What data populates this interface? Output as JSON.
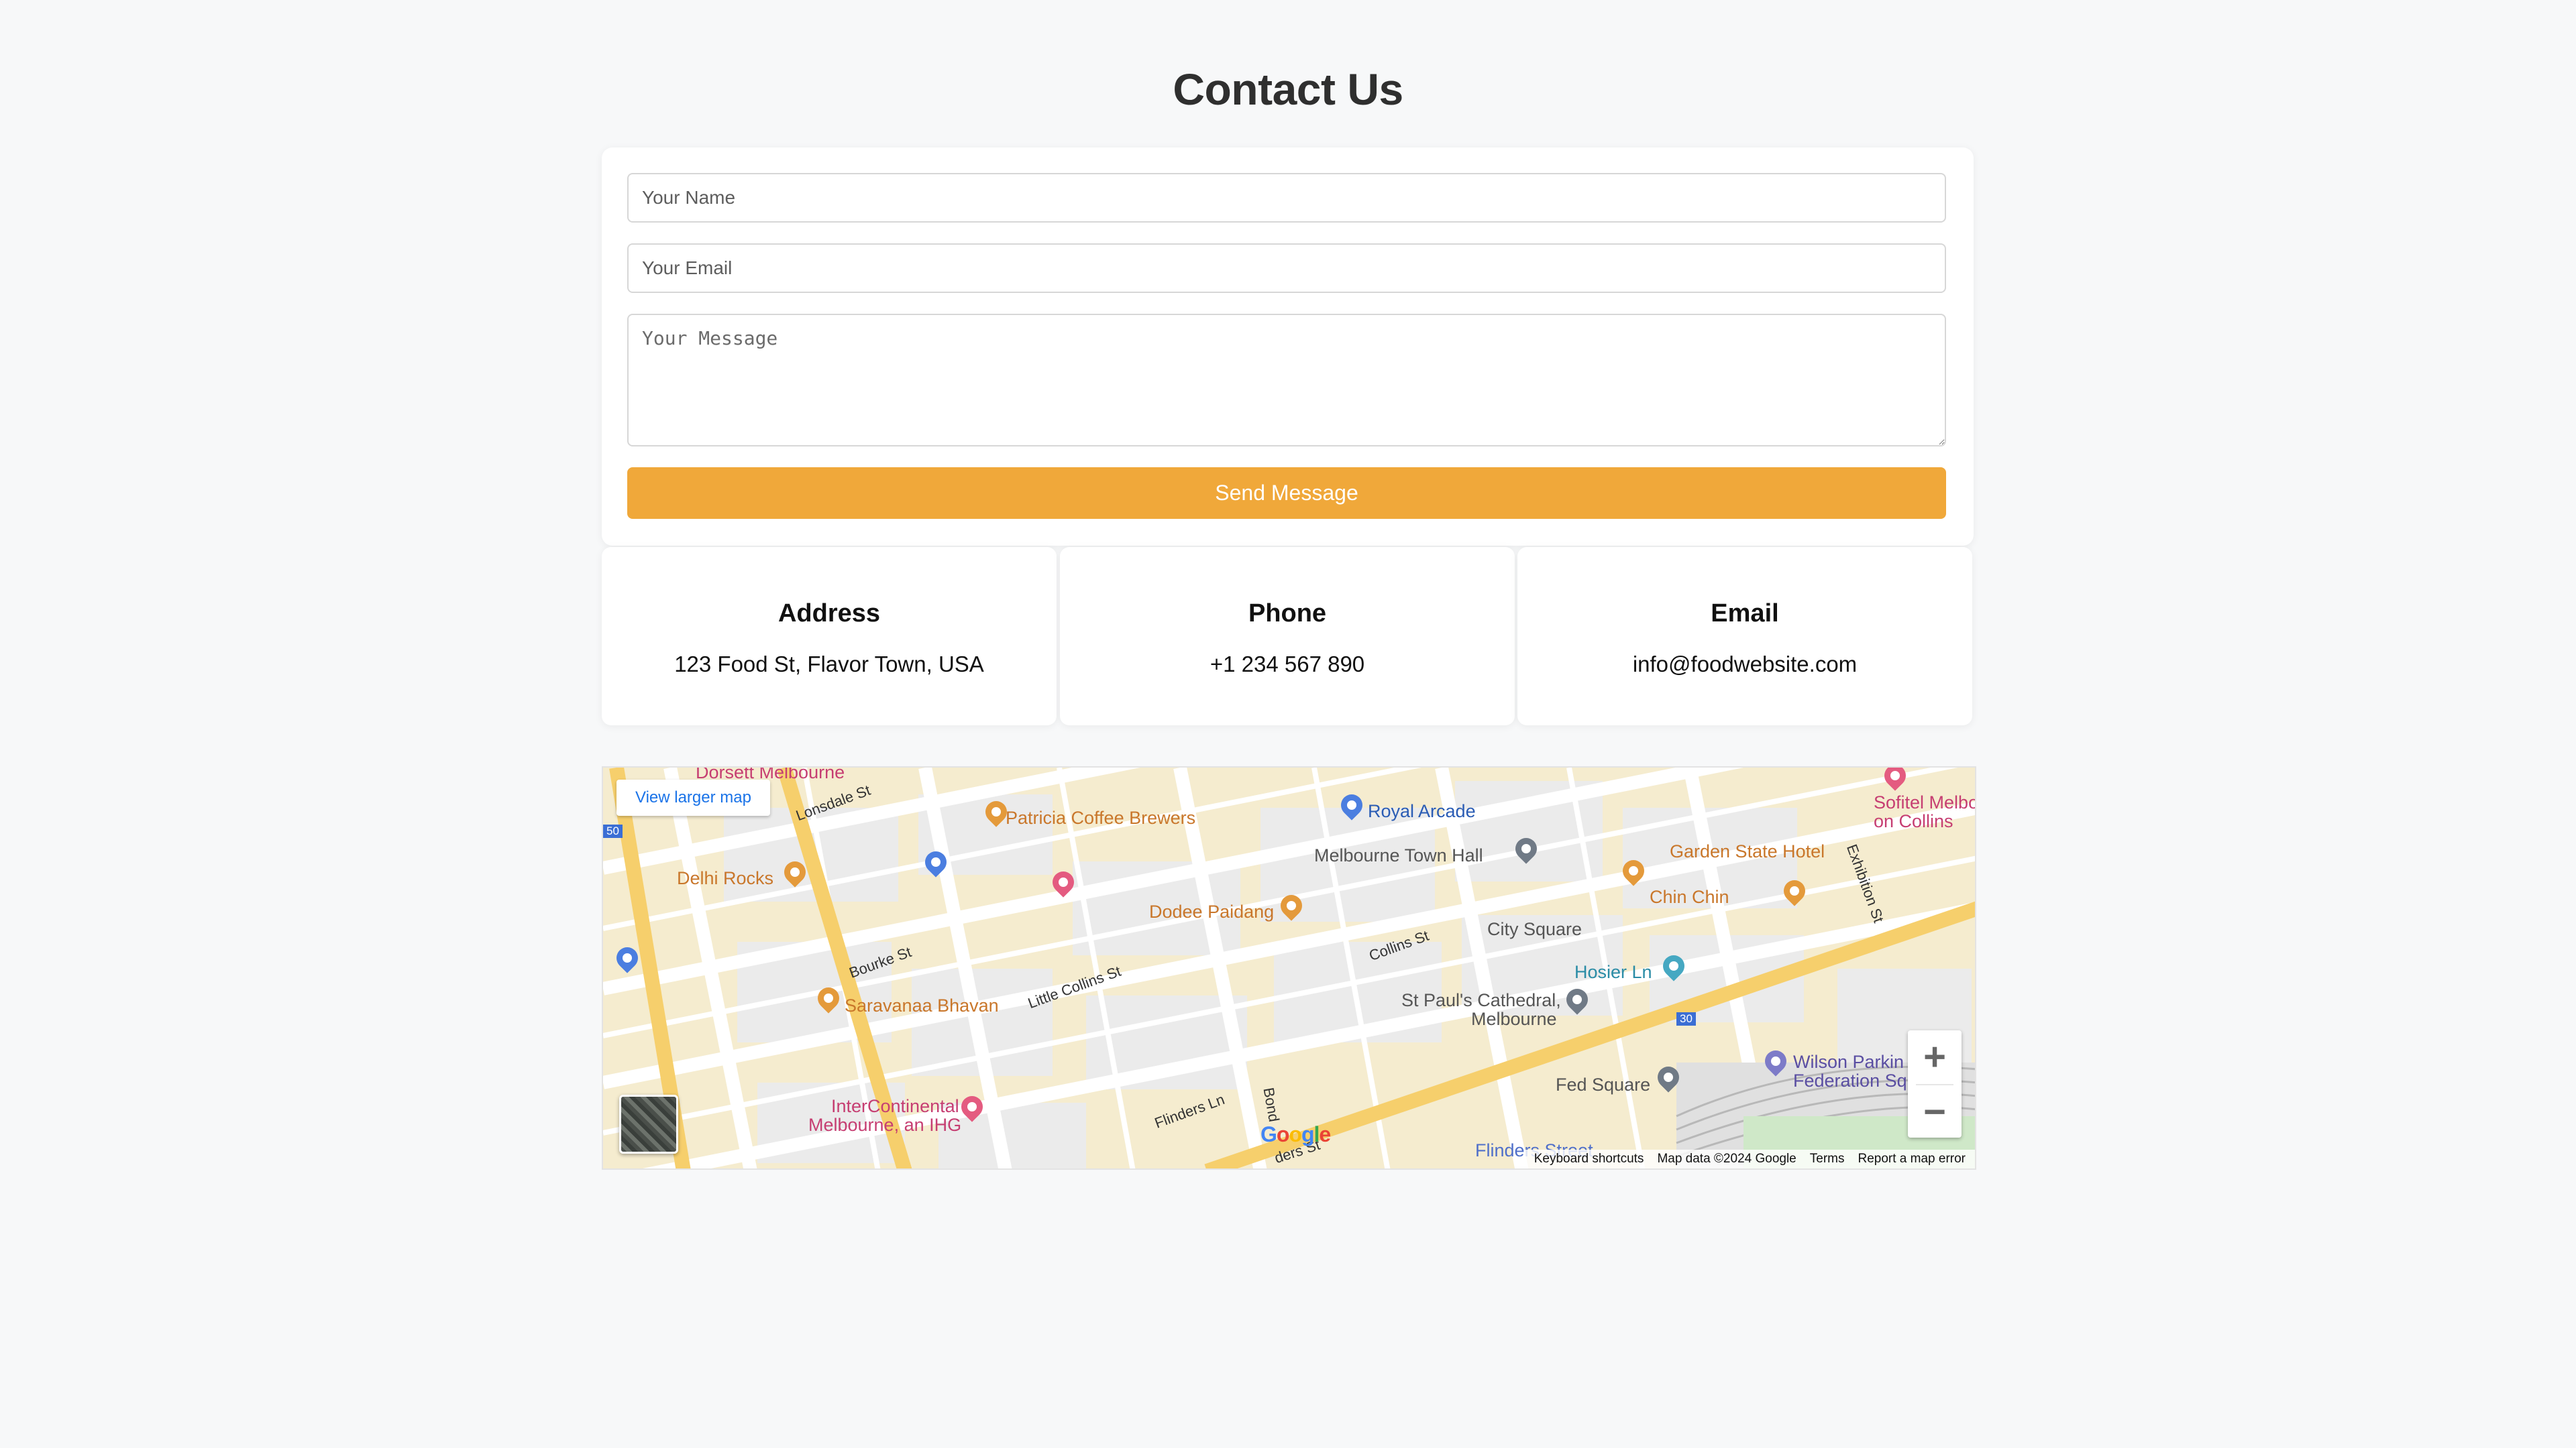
{
  "page": {
    "title": "Contact Us"
  },
  "form": {
    "name_placeholder": "Your Name",
    "email_placeholder": "Your Email",
    "message_placeholder": "Your Message",
    "send_label": "Send Message"
  },
  "contact_info": [
    {
      "heading": "Address",
      "value": "123 Food St, Flavor Town, USA"
    },
    {
      "heading": "Phone",
      "value": "+1 234 567 890"
    },
    {
      "heading": "Email",
      "value": "info@foodwebsite.com"
    }
  ],
  "map": {
    "view_larger_label": "View larger map",
    "google_logo": "Google",
    "zoom_in_label": "+",
    "zoom_out_label": "−",
    "attribution": {
      "keyboard": "Keyboard shortcuts",
      "data": "Map data ©2024 Google",
      "terms": "Terms",
      "report": "Report a map error"
    },
    "places": {
      "dorsett": "Dorsett Melbourne",
      "patricia": "Patricia Coffee Brewers",
      "royal_arcade": "Royal Arcade",
      "sofitel": "Sofitel Melbo\non Collins",
      "delhi": "Delhi Rocks",
      "town_hall": "Melbourne Town Hall",
      "garden_state": "Garden State Hotel",
      "chin_chin": "Chin Chin",
      "dodee": "Dodee Paidang",
      "city_square": "City Square",
      "hosier": "Hosier Ln",
      "saravanaa": "Saravanaa Bhavan",
      "st_pauls_1": "St Paul's Cathedral,",
      "st_pauls_2": "Melbourne",
      "wilson_1": "Wilson Parkin",
      "wilson_2": "Federation Sq",
      "fed_square": "Fed Square",
      "intercon_1": "InterContinental",
      "intercon_2": "Melbourne, an IHG",
      "flinders_station": "Flinders Street"
    },
    "streets": {
      "lonsdale": "Lonsdale St",
      "bourke": "Bourke St",
      "little_collins": "Little Collins St",
      "collins": "Collins St",
      "flinders_ln": "Flinders Ln",
      "bond": "Bond",
      "exhibition": "Exhibition St",
      "flinders_st": "ders St",
      "route_30a": "30",
      "route_30b": "30",
      "route_50": "50"
    }
  }
}
